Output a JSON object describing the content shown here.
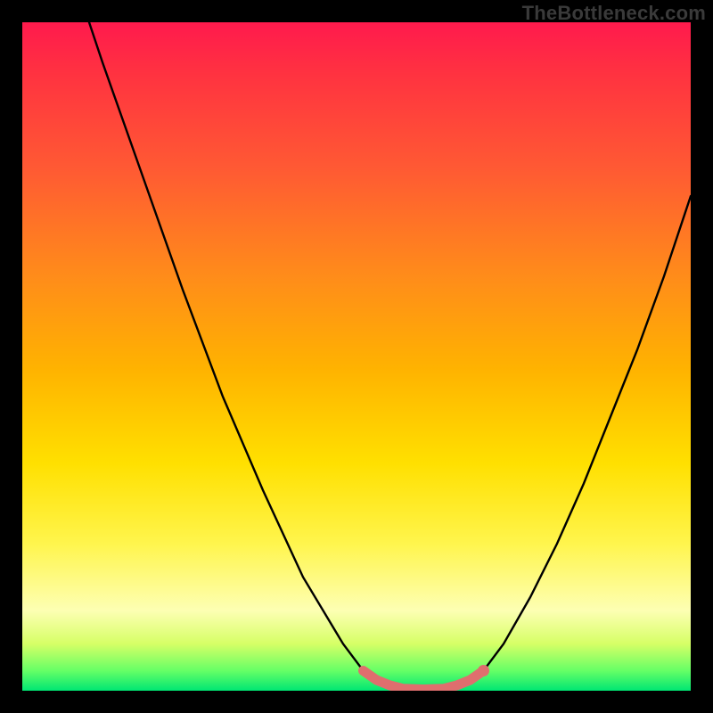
{
  "watermark": "TheBottleneck.com",
  "chart_data": {
    "type": "line",
    "title": "",
    "xlabel": "",
    "ylabel": "",
    "xlim": [
      0,
      100
    ],
    "ylim": [
      0,
      100
    ],
    "grid": false,
    "legend": false,
    "series": [
      {
        "name": "bottleneck-curve",
        "color": "#000000",
        "x": [
          0,
          6,
          12,
          18,
          24,
          30,
          36,
          42,
          48,
          51,
          54,
          57,
          60,
          63,
          66,
          69,
          72,
          76,
          80,
          84,
          88,
          92,
          96,
          100
        ],
        "values": [
          130,
          112,
          94,
          77,
          60,
          44,
          30,
          17,
          7,
          3,
          1,
          0,
          0,
          0,
          1,
          3,
          7,
          14,
          22,
          31,
          41,
          51,
          62,
          74
        ]
      },
      {
        "name": "flat-region-highlight",
        "color": "#e06c6c",
        "x": [
          51,
          53,
          55,
          57,
          60,
          63,
          65,
          67,
          69
        ],
        "values": [
          3,
          1.6,
          0.8,
          0.3,
          0.2,
          0.3,
          0.8,
          1.6,
          3
        ]
      }
    ],
    "annotations": [
      {
        "type": "dot",
        "x": 69,
        "y": 3,
        "color": "#e06c6c"
      }
    ],
    "gradient_bands": [
      {
        "y": 100,
        "color": "#ff1a4d"
      },
      {
        "y": 80,
        "color": "#ff8c1a"
      },
      {
        "y": 60,
        "color": "#ffcc00"
      },
      {
        "y": 40,
        "color": "#fff066"
      },
      {
        "y": 20,
        "color": "#fdffb3"
      },
      {
        "y": 3,
        "color": "#66ff66"
      },
      {
        "y": 0,
        "color": "#00e673"
      }
    ]
  }
}
